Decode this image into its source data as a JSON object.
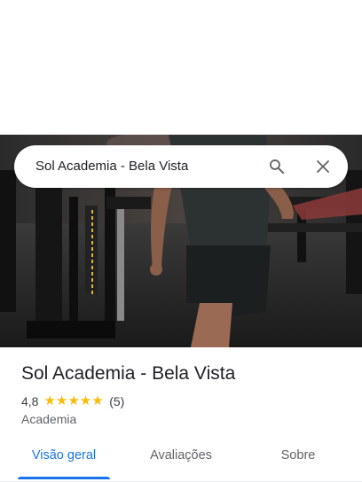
{
  "search": {
    "query": "Sol Academia - Bela Vista"
  },
  "place": {
    "name": "Sol Academia - Bela Vista",
    "rating": "4,8",
    "stars": "★★★★★",
    "review_count": "(5)",
    "category": "Academia"
  },
  "tabs": [
    {
      "label": "Visão geral",
      "active": true
    },
    {
      "label": "Avaliações",
      "active": false
    },
    {
      "label": "Sobre",
      "active": false
    }
  ],
  "colors": {
    "accent": "#1a73e8",
    "star": "#fbbc04",
    "text_primary": "#202124",
    "text_secondary": "#5f6368"
  },
  "icons": {
    "search": "search-icon",
    "close": "close-icon"
  }
}
